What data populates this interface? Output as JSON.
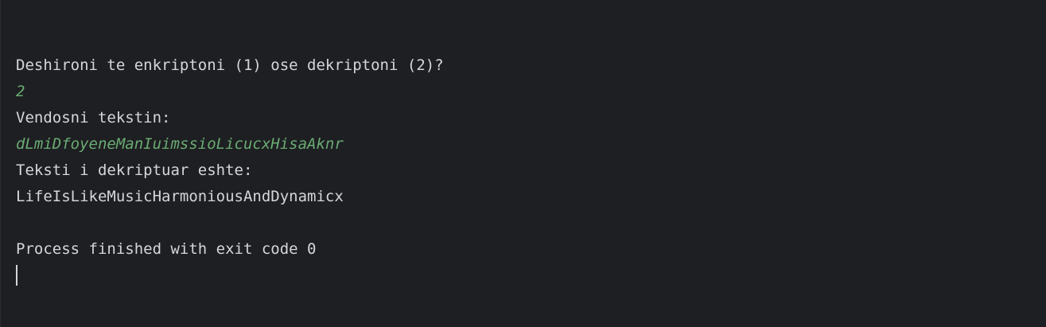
{
  "console": {
    "lines": [
      {
        "text": "Deshironi te enkriptoni (1) ose dekriptoni (2)?",
        "kind": "output"
      },
      {
        "text": "2",
        "kind": "input"
      },
      {
        "text": "Vendosni tekstin:",
        "kind": "output"
      },
      {
        "text": "dLmiDfoyeneManIuimssioLicucxHisaAknr",
        "kind": "input"
      },
      {
        "text": "Teksti i dekriptuar eshte:",
        "kind": "output"
      },
      {
        "text": "LifeIsLikeMusicHarmoniousAndDynamicx",
        "kind": "output"
      },
      {
        "text": "",
        "kind": "blank"
      },
      {
        "text": "Process finished with exit code 0",
        "kind": "output"
      }
    ],
    "colors": {
      "background": "#1e1f22",
      "output_text": "#d4d6db",
      "input_text": "#6aab73"
    }
  }
}
